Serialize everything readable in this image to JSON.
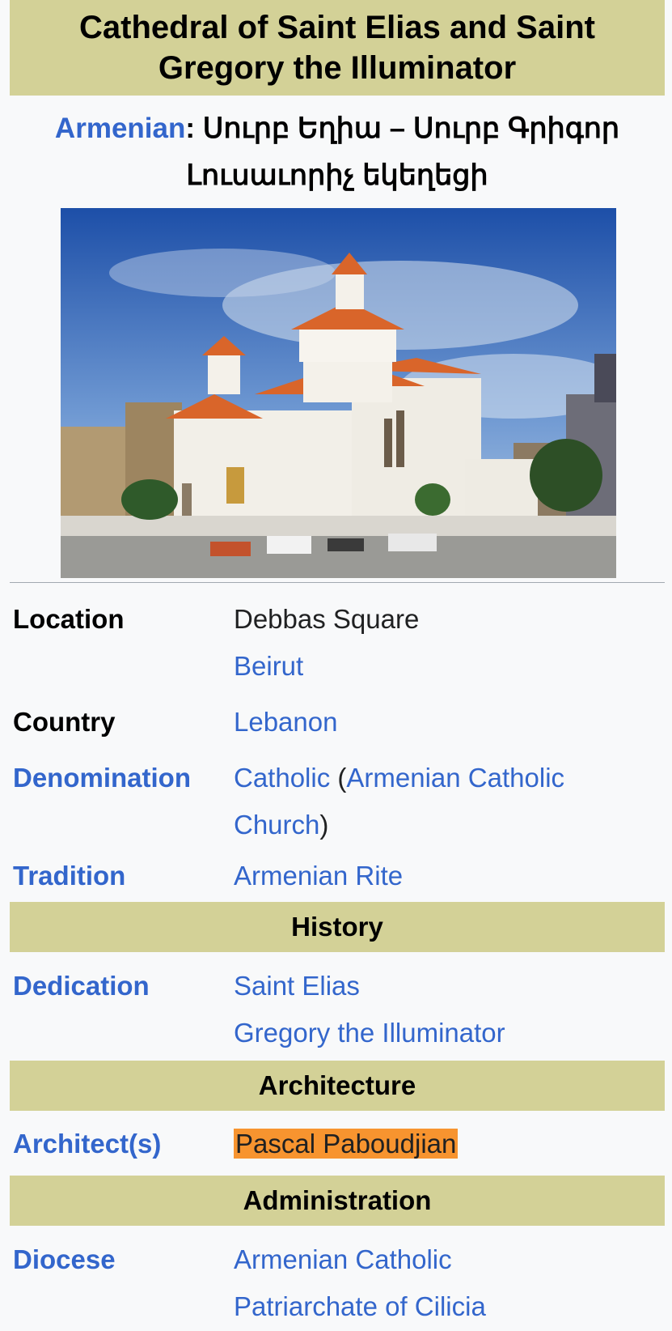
{
  "title": "Cathedral of Saint Elias and Saint Gregory the Illuminator",
  "subtitle": {
    "language_link": "Armenian",
    "separator": ":",
    "native_line1": "Սուրբ Եղիա – Սուրբ Գրիգոր",
    "native_line2": "Լուսաւորիչ եկեղեցի"
  },
  "colors": {
    "header_bg": "#d3d197",
    "link": "#3366cc",
    "highlight": "#f7942f",
    "box_bg": "#f8f9fa"
  },
  "rows": {
    "location": {
      "label": "Location",
      "value1": "Debbas Square",
      "value2": "Beirut"
    },
    "country": {
      "label": "Country",
      "value": "Lebanon"
    },
    "denomination": {
      "label": "Denomination",
      "value_link1": "Catholic",
      "paren_open": " (",
      "value_link2": "Armenian Catholic",
      "value_link3": "Church",
      "paren_close": ")"
    },
    "tradition": {
      "label": "Tradition",
      "value": "Armenian Rite"
    },
    "dedication": {
      "label": "Dedication",
      "value1": "Saint Elias",
      "value2": "Gregory the Illuminator"
    },
    "architects": {
      "label": "Architect(s)",
      "value": "Pascal Paboudjian"
    },
    "diocese": {
      "label": "Diocese",
      "value1": "Armenian Catholic",
      "value2": "Patriarchate of Cilicia"
    }
  },
  "sections": {
    "history": "History",
    "architecture": "Architecture",
    "administration": "Administration"
  }
}
